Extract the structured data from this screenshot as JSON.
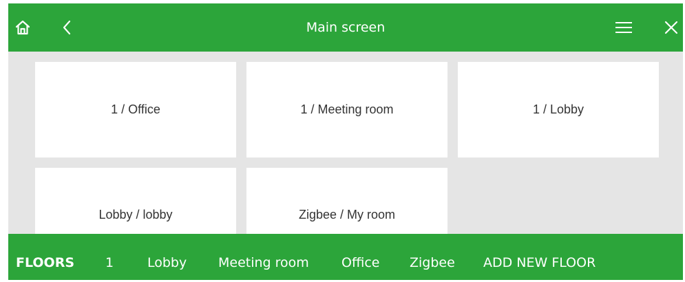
{
  "header": {
    "title": "Main screen",
    "icons": {
      "home": "home-icon",
      "back": "chevron-left-icon",
      "menu": "hamburger-menu-icon",
      "close": "close-icon"
    }
  },
  "rooms": [
    {
      "label": "1 / Office"
    },
    {
      "label": "1 / Meeting room"
    },
    {
      "label": "1 / Lobby"
    },
    {
      "label": "Lobby / lobby"
    },
    {
      "label": "Zigbee / My room"
    }
  ],
  "floors_bar": {
    "heading": "FLOORS",
    "tabs": [
      {
        "label": "1"
      },
      {
        "label": "Lobby"
      },
      {
        "label": "Meeting room"
      },
      {
        "label": "Office"
      },
      {
        "label": "Zigbee"
      }
    ],
    "add_label": "ADD NEW FLOOR"
  },
  "colors": {
    "accent": "#2ca53a",
    "background": "#e5e5e5",
    "tile": "#ffffff"
  }
}
